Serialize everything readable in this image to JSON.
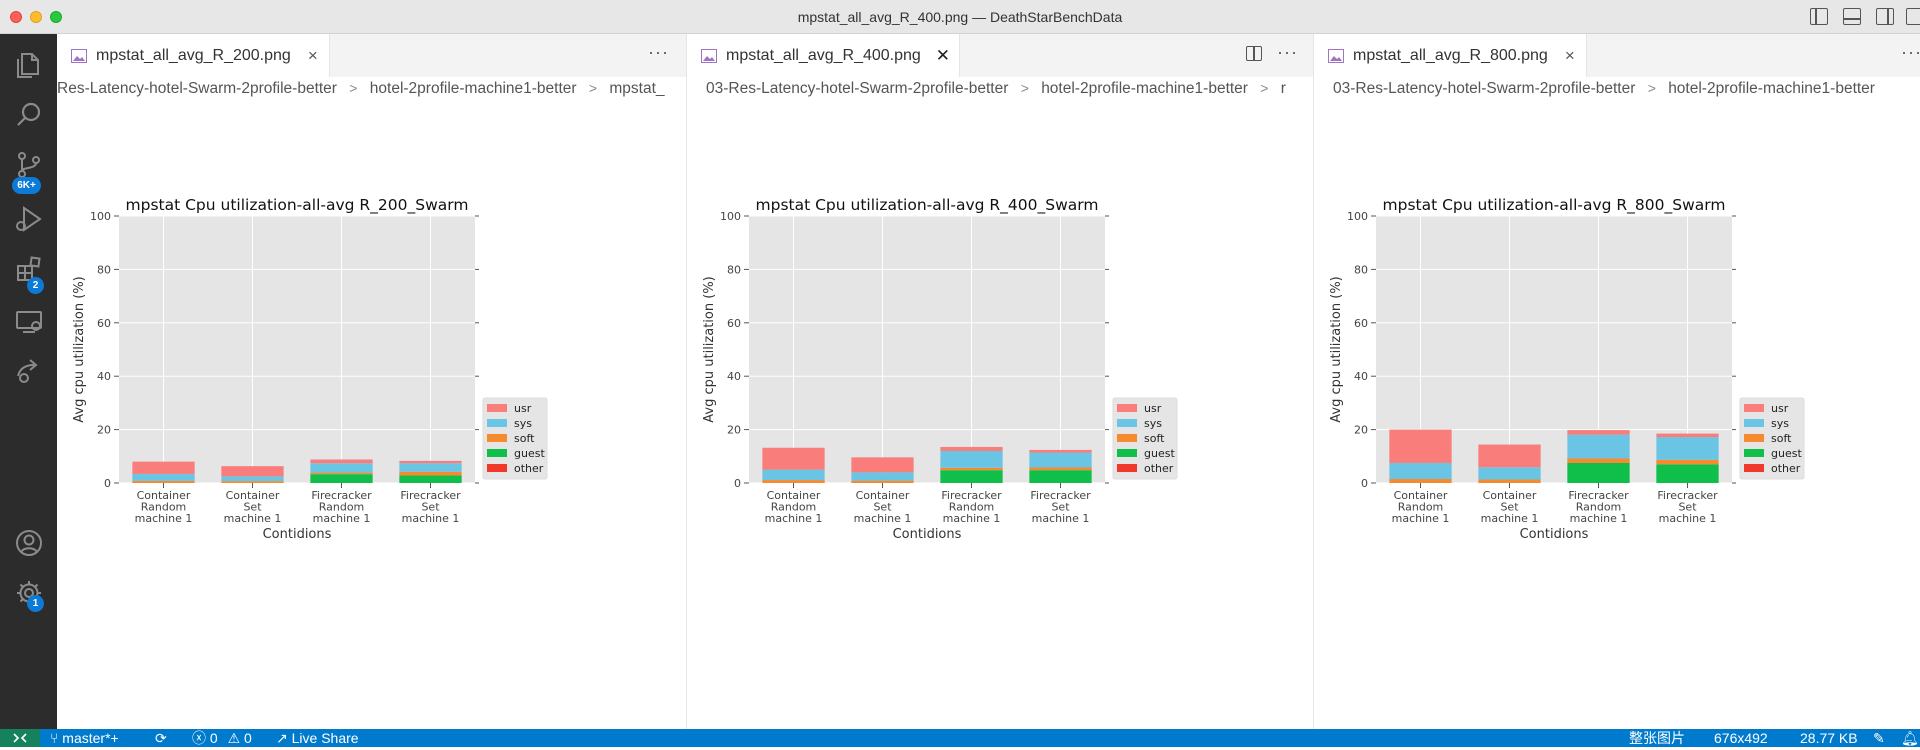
{
  "window": {
    "title": "mpstat_all_avg_R_400.png — DeathStarBenchData"
  },
  "activity": {
    "scm_badge": "6K+",
    "extensions_badge": "2",
    "manage_badge": "1"
  },
  "panes": [
    {
      "tab_label": "mpstat_all_avg_R_200.png",
      "crumbs": [
        "Res-Latency-hotel-Swarm-2profile-better",
        "hotel-2profile-machine1-better",
        "mpstat_"
      ]
    },
    {
      "tab_label": "mpstat_all_avg_R_400.png",
      "crumbs": [
        "03-Res-Latency-hotel-Swarm-2profile-better",
        "hotel-2profile-machine1-better",
        "r"
      ]
    },
    {
      "tab_label": "mpstat_all_avg_R_800.png",
      "crumbs": [
        "03-Res-Latency-hotel-Swarm-2profile-better",
        "hotel-2profile-machine1-better"
      ]
    }
  ],
  "icons": {
    "activity": [
      "explorer-icon",
      "search-icon",
      "source-control-icon",
      "run-debug-icon",
      "extensions-icon",
      "remote-explorer-icon",
      "live-share-icon",
      "account-icon",
      "manage-gear-icon"
    ],
    "colors": {
      "statusbar": "#007acc",
      "activitybar": "#2c2c2c",
      "badge": "#0c7ad7"
    }
  },
  "chart_data": [
    {
      "type": "bar",
      "title": "mpstat Cpu utilization-all-avg R_200_Swarm",
      "xlabel": "Contidions",
      "ylabel": "Avg cpu utilization (%)",
      "ylim": [
        0,
        100
      ],
      "yticks": [
        "0",
        "20",
        "40",
        "60",
        "80",
        "100"
      ],
      "categories": [
        [
          "Container",
          "Random",
          "machine 1"
        ],
        [
          "Container",
          "Set",
          "machine 1"
        ],
        [
          "Firecracker",
          "Random",
          "machine 1"
        ],
        [
          "Firecracker",
          "Set",
          "machine 1"
        ]
      ],
      "stacked": true,
      "grid": true,
      "legend_position": "lower-right-outside",
      "series": [
        {
          "name": "usr",
          "color": "#f87d7b",
          "values": [
            4.6,
            3.8,
            1.4,
            0.9
          ]
        },
        {
          "name": "sys",
          "color": "#6ac4e3",
          "values": [
            2.6,
            1.8,
            3.5,
            3.2
          ]
        },
        {
          "name": "soft",
          "color": "#f58a2f",
          "values": [
            0.8,
            0.7,
            0.6,
            1.4
          ]
        },
        {
          "name": "guest",
          "color": "#0fbf4a",
          "values": [
            0,
            0,
            3.3,
            2.8
          ]
        },
        {
          "name": "other",
          "color": "#f0392b",
          "values": [
            0,
            0,
            0,
            0
          ]
        }
      ]
    },
    {
      "type": "bar",
      "title": "mpstat Cpu utilization-all-avg R_400_Swarm",
      "xlabel": "Contidions",
      "ylabel": "Avg cpu utilization (%)",
      "ylim": [
        0,
        100
      ],
      "yticks": [
        "0",
        "20",
        "40",
        "60",
        "80",
        "100"
      ],
      "categories": [
        [
          "Container",
          "Random",
          "machine 1"
        ],
        [
          "Container",
          "Set",
          "machine 1"
        ],
        [
          "Firecracker",
          "Random",
          "machine 1"
        ],
        [
          "Firecracker",
          "Set",
          "machine 1"
        ]
      ],
      "stacked": true,
      "grid": true,
      "legend_position": "lower-right-outside",
      "series": [
        {
          "name": "usr",
          "color": "#f87d7b",
          "values": [
            8.2,
            5.6,
            1.5,
            1.0
          ]
        },
        {
          "name": "sys",
          "color": "#6ac4e3",
          "values": [
            3.9,
            3.1,
            6.3,
            5.6
          ]
        },
        {
          "name": "soft",
          "color": "#f58a2f",
          "values": [
            1.1,
            0.9,
            0.9,
            1.0
          ]
        },
        {
          "name": "guest",
          "color": "#0fbf4a",
          "values": [
            0,
            0,
            4.8,
            4.8
          ]
        },
        {
          "name": "other",
          "color": "#f0392b",
          "values": [
            0,
            0,
            0,
            0
          ]
        }
      ]
    },
    {
      "type": "bar",
      "title": "mpstat Cpu utilization-all-avg R_800_Swarm",
      "xlabel": "Contidions",
      "ylabel": "Avg cpu utilization (%)",
      "ylim": [
        0,
        100
      ],
      "yticks": [
        "0",
        "20",
        "40",
        "60",
        "80",
        "100"
      ],
      "categories": [
        [
          "Container",
          "Random",
          "machine 1"
        ],
        [
          "Container",
          "Set",
          "machine 1"
        ],
        [
          "Firecracker",
          "Random",
          "machine 1"
        ],
        [
          "Firecracker",
          "Set",
          "machine 1"
        ]
      ],
      "stacked": true,
      "grid": true,
      "legend_position": "lower-right-outside",
      "series": [
        {
          "name": "usr",
          "color": "#f87d7b",
          "values": [
            12.5,
            8.5,
            1.7,
            1.3
          ]
        },
        {
          "name": "sys",
          "color": "#6ac4e3",
          "values": [
            6.0,
            4.6,
            8.9,
            8.5
          ]
        },
        {
          "name": "soft",
          "color": "#f58a2f",
          "values": [
            1.5,
            1.3,
            1.7,
            1.7
          ]
        },
        {
          "name": "guest",
          "color": "#0fbf4a",
          "values": [
            0,
            0,
            7.5,
            7.0
          ]
        },
        {
          "name": "other",
          "color": "#f0392b",
          "values": [
            0,
            0,
            0,
            0
          ]
        }
      ]
    }
  ],
  "status": {
    "branch": "master*+",
    "problems": "0",
    "warnings": "0",
    "live_share": "Live Share",
    "image_label": "整张图片",
    "dimensions": "676x492",
    "file_size": "28.77 KB"
  }
}
